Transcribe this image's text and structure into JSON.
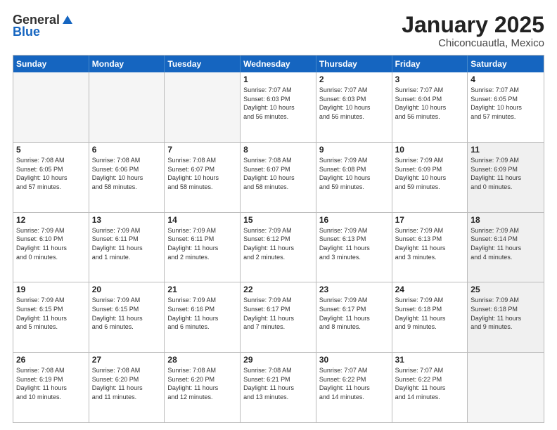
{
  "logo": {
    "general": "General",
    "blue": "Blue"
  },
  "title": "January 2025",
  "subtitle": "Chiconcuautla, Mexico",
  "days": [
    "Sunday",
    "Monday",
    "Tuesday",
    "Wednesday",
    "Thursday",
    "Friday",
    "Saturday"
  ],
  "weeks": [
    [
      {
        "day": "",
        "info": "",
        "empty": true
      },
      {
        "day": "",
        "info": "",
        "empty": true
      },
      {
        "day": "",
        "info": "",
        "empty": true
      },
      {
        "day": "1",
        "info": "Sunrise: 7:07 AM\nSunset: 6:03 PM\nDaylight: 10 hours\nand 56 minutes."
      },
      {
        "day": "2",
        "info": "Sunrise: 7:07 AM\nSunset: 6:03 PM\nDaylight: 10 hours\nand 56 minutes."
      },
      {
        "day": "3",
        "info": "Sunrise: 7:07 AM\nSunset: 6:04 PM\nDaylight: 10 hours\nand 56 minutes."
      },
      {
        "day": "4",
        "info": "Sunrise: 7:07 AM\nSunset: 6:05 PM\nDaylight: 10 hours\nand 57 minutes."
      }
    ],
    [
      {
        "day": "5",
        "info": "Sunrise: 7:08 AM\nSunset: 6:05 PM\nDaylight: 10 hours\nand 57 minutes."
      },
      {
        "day": "6",
        "info": "Sunrise: 7:08 AM\nSunset: 6:06 PM\nDaylight: 10 hours\nand 58 minutes."
      },
      {
        "day": "7",
        "info": "Sunrise: 7:08 AM\nSunset: 6:07 PM\nDaylight: 10 hours\nand 58 minutes."
      },
      {
        "day": "8",
        "info": "Sunrise: 7:08 AM\nSunset: 6:07 PM\nDaylight: 10 hours\nand 58 minutes."
      },
      {
        "day": "9",
        "info": "Sunrise: 7:09 AM\nSunset: 6:08 PM\nDaylight: 10 hours\nand 59 minutes."
      },
      {
        "day": "10",
        "info": "Sunrise: 7:09 AM\nSunset: 6:09 PM\nDaylight: 10 hours\nand 59 minutes."
      },
      {
        "day": "11",
        "info": "Sunrise: 7:09 AM\nSunset: 6:09 PM\nDaylight: 11 hours\nand 0 minutes.",
        "shaded": true
      }
    ],
    [
      {
        "day": "12",
        "info": "Sunrise: 7:09 AM\nSunset: 6:10 PM\nDaylight: 11 hours\nand 0 minutes."
      },
      {
        "day": "13",
        "info": "Sunrise: 7:09 AM\nSunset: 6:11 PM\nDaylight: 11 hours\nand 1 minute."
      },
      {
        "day": "14",
        "info": "Sunrise: 7:09 AM\nSunset: 6:11 PM\nDaylight: 11 hours\nand 2 minutes."
      },
      {
        "day": "15",
        "info": "Sunrise: 7:09 AM\nSunset: 6:12 PM\nDaylight: 11 hours\nand 2 minutes."
      },
      {
        "day": "16",
        "info": "Sunrise: 7:09 AM\nSunset: 6:13 PM\nDaylight: 11 hours\nand 3 minutes."
      },
      {
        "day": "17",
        "info": "Sunrise: 7:09 AM\nSunset: 6:13 PM\nDaylight: 11 hours\nand 3 minutes."
      },
      {
        "day": "18",
        "info": "Sunrise: 7:09 AM\nSunset: 6:14 PM\nDaylight: 11 hours\nand 4 minutes.",
        "shaded": true
      }
    ],
    [
      {
        "day": "19",
        "info": "Sunrise: 7:09 AM\nSunset: 6:15 PM\nDaylight: 11 hours\nand 5 minutes."
      },
      {
        "day": "20",
        "info": "Sunrise: 7:09 AM\nSunset: 6:15 PM\nDaylight: 11 hours\nand 6 minutes."
      },
      {
        "day": "21",
        "info": "Sunrise: 7:09 AM\nSunset: 6:16 PM\nDaylight: 11 hours\nand 6 minutes."
      },
      {
        "day": "22",
        "info": "Sunrise: 7:09 AM\nSunset: 6:17 PM\nDaylight: 11 hours\nand 7 minutes."
      },
      {
        "day": "23",
        "info": "Sunrise: 7:09 AM\nSunset: 6:17 PM\nDaylight: 11 hours\nand 8 minutes."
      },
      {
        "day": "24",
        "info": "Sunrise: 7:09 AM\nSunset: 6:18 PM\nDaylight: 11 hours\nand 9 minutes."
      },
      {
        "day": "25",
        "info": "Sunrise: 7:09 AM\nSunset: 6:18 PM\nDaylight: 11 hours\nand 9 minutes.",
        "shaded": true
      }
    ],
    [
      {
        "day": "26",
        "info": "Sunrise: 7:08 AM\nSunset: 6:19 PM\nDaylight: 11 hours\nand 10 minutes."
      },
      {
        "day": "27",
        "info": "Sunrise: 7:08 AM\nSunset: 6:20 PM\nDaylight: 11 hours\nand 11 minutes."
      },
      {
        "day": "28",
        "info": "Sunrise: 7:08 AM\nSunset: 6:20 PM\nDaylight: 11 hours\nand 12 minutes."
      },
      {
        "day": "29",
        "info": "Sunrise: 7:08 AM\nSunset: 6:21 PM\nDaylight: 11 hours\nand 13 minutes."
      },
      {
        "day": "30",
        "info": "Sunrise: 7:07 AM\nSunset: 6:22 PM\nDaylight: 11 hours\nand 14 minutes."
      },
      {
        "day": "31",
        "info": "Sunrise: 7:07 AM\nSunset: 6:22 PM\nDaylight: 11 hours\nand 14 minutes."
      },
      {
        "day": "",
        "info": "",
        "empty": true
      }
    ]
  ]
}
